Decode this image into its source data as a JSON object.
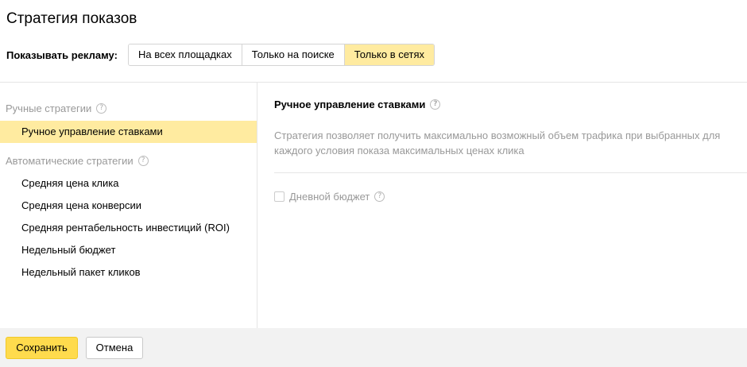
{
  "title": "Стратегия показов",
  "show_ads": {
    "label": "Показывать рекламу:",
    "options": [
      "На всех площадках",
      "Только на поиске",
      "Только в сетях"
    ],
    "selected": "Только в сетях"
  },
  "sidebar": {
    "manual_header": "Ручные стратегии",
    "manual_items": [
      "Ручное управление ставками"
    ],
    "auto_header": "Автоматические стратегии",
    "auto_items": [
      "Средняя цена клика",
      "Средняя цена конверсии",
      "Средняя рентабельность инвестиций (ROI)",
      "Недельный бюджет",
      "Недельный пакет кликов"
    ],
    "selected": "Ручное управление ставками"
  },
  "content": {
    "title": "Ручное управление ставками",
    "description": "Стратегия позволяет получить максимально возможный объем трафика при выбранных для каждого условия показа максимальных ценах клика",
    "daily_budget_label": "Дневной бюджет",
    "daily_budget_checked": false
  },
  "footer": {
    "save_label": "Сохранить",
    "cancel_label": "Отмена"
  },
  "icons": {
    "help": "question-circle-icon",
    "checkbox": "checkbox-icon"
  },
  "colors": {
    "accent_yellow": "#ffdb4d",
    "selected_bg": "#ffeba0",
    "muted_text": "#999999",
    "footer_bg": "#f2f2f2"
  }
}
